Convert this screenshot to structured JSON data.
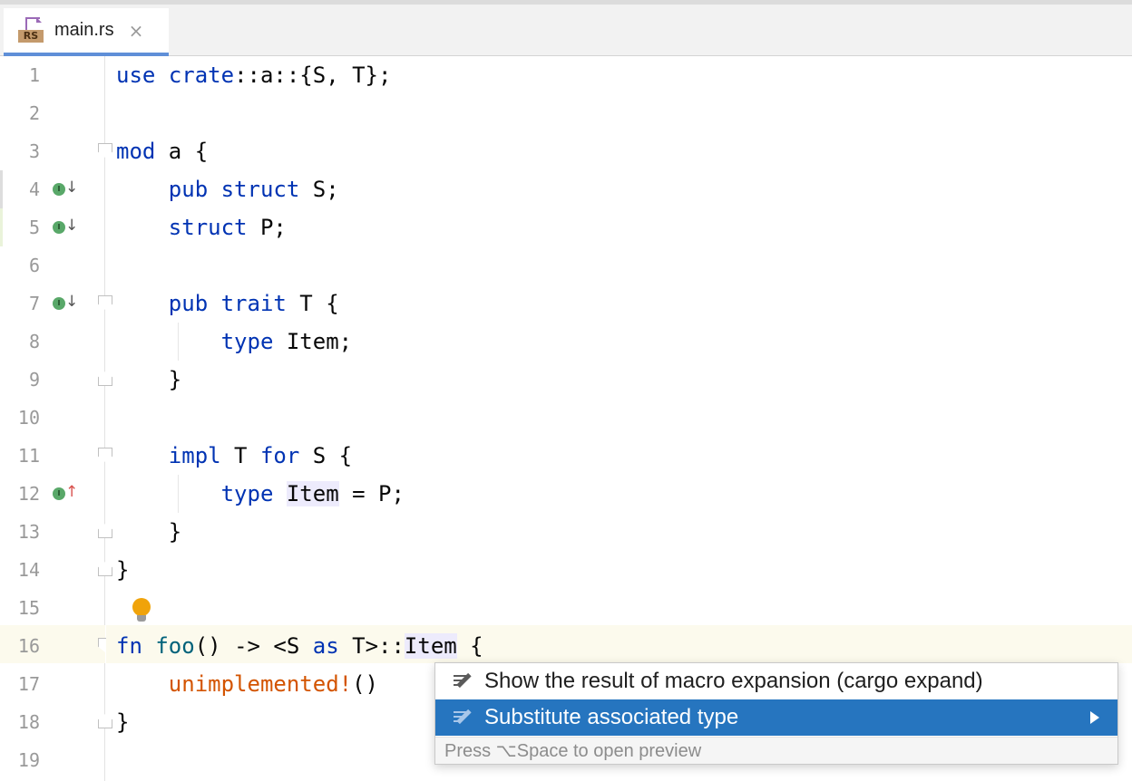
{
  "tab": {
    "file_badge": "RS",
    "title": "main.rs",
    "close": "×"
  },
  "lines": [
    {
      "n": "1"
    },
    {
      "n": "2"
    },
    {
      "n": "3"
    },
    {
      "n": "4"
    },
    {
      "n": "5"
    },
    {
      "n": "6"
    },
    {
      "n": "7"
    },
    {
      "n": "8"
    },
    {
      "n": "9"
    },
    {
      "n": "10"
    },
    {
      "n": "11"
    },
    {
      "n": "12"
    },
    {
      "n": "13"
    },
    {
      "n": "14"
    },
    {
      "n": "15"
    },
    {
      "n": "16"
    },
    {
      "n": "17"
    },
    {
      "n": "18"
    },
    {
      "n": "19"
    }
  ],
  "code": {
    "l1": {
      "kw_use": "use",
      "kw_crate": "crate",
      "rest": "::a::{S, T};"
    },
    "l3": {
      "kw": "mod",
      "rest": " a {"
    },
    "l4": {
      "kw1": "pub",
      "kw2": "struct",
      "rest": " S;"
    },
    "l5": {
      "kw": "struct",
      "rest": " P;"
    },
    "l7": {
      "kw1": "pub",
      "kw2": "trait",
      "rest": " T {"
    },
    "l8": {
      "kw": "type",
      "rest": " Item;"
    },
    "l9": {
      "rest": "}"
    },
    "l11": {
      "kw1": "impl",
      "mid": " T ",
      "kw2": "for",
      "rest": " S {"
    },
    "l12": {
      "kw": "type",
      "hl": "Item",
      "rest": " = P;"
    },
    "l13": {
      "rest": "}"
    },
    "l14": {
      "rest": "}"
    },
    "l16": {
      "kw": "fn",
      "fname": "foo",
      "mid": "() -> <S ",
      "kw2": "as",
      "mid2": " T>::",
      "hl": "Item",
      "rest": " {"
    },
    "l17": {
      "mac": "unimplemented!",
      "rest": "()"
    },
    "l18": {
      "rest": "}"
    }
  },
  "gutter_icons": {
    "impl_marker": "I",
    "down_arrow": "↓",
    "up_arrow": "↑"
  },
  "popup": {
    "items": [
      {
        "label": "Show the result of macro expansion (cargo expand)"
      },
      {
        "label": "Substitute associated type"
      }
    ],
    "footer": "Press ⌥Space to open preview"
  },
  "colors": {
    "keyword": "#0033b3",
    "function": "#00627a",
    "macro": "#d35400",
    "selection": "#2675bf",
    "current_line": "#fcfaed",
    "identifier_highlight": "#edebfc"
  },
  "icons": {
    "file": "rust-file-icon",
    "close": "close-icon",
    "implements": "implements-icon",
    "implemented": "implemented-icon",
    "intention": "lightbulb-icon",
    "intention_action": "intention-action-icon",
    "submenu": "chevron-right-icon"
  }
}
